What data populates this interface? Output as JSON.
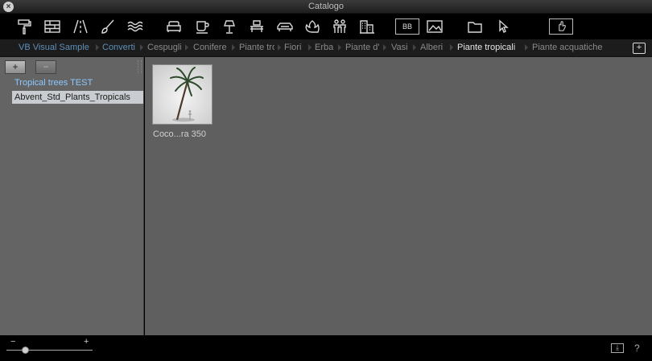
{
  "window": {
    "title": "Catalogo",
    "close_glyph": "×"
  },
  "toolbar": {
    "icons": [
      "paint-roller-icon",
      "brick-wall-icon",
      "road-icon",
      "brush-icon",
      "water-icon",
      "sofa-icon",
      "cup-icon",
      "lamp-icon",
      "table-icon",
      "car-icon",
      "plant-icon",
      "people-icon",
      "building-icon",
      "billboard-icon",
      "image-icon",
      "folder-icon",
      "pointer-icon",
      "hand-icon"
    ],
    "billboard_text": "BB"
  },
  "breadcrumb": {
    "items": [
      {
        "label": "VB Visual Sample",
        "state": "link"
      },
      {
        "label": "Converti",
        "state": "link"
      },
      {
        "label": "Cespugli",
        "state": "normal"
      },
      {
        "label": "Conifere",
        "state": "normal"
      },
      {
        "label": "Piante tropicali",
        "state": "normal"
      },
      {
        "label": "Fiori",
        "state": "normal"
      },
      {
        "label": "Erba",
        "state": "normal"
      },
      {
        "label": "Piante d'appartamento",
        "state": "normal"
      },
      {
        "label": "Vasi",
        "state": "normal"
      },
      {
        "label": "Alberi",
        "state": "normal"
      },
      {
        "label": "Piante tropicali",
        "state": "active"
      },
      {
        "label": "Piante acquatiche",
        "state": "normal"
      }
    ],
    "add_folder_glyph": "+"
  },
  "sidebar": {
    "add_button": "+",
    "remove_button": "−",
    "items": [
      {
        "label": "Tropical trees TEST",
        "state": "link"
      },
      {
        "label": "Abvent_Std_Plants_Tropicals",
        "state": "selected"
      }
    ]
  },
  "content": {
    "items": [
      {
        "label": "Coco...ra 350"
      }
    ]
  },
  "statusbar": {
    "zoom_minus": "−",
    "zoom_plus": "+",
    "zoom_level": 0.22,
    "help": "?"
  }
}
